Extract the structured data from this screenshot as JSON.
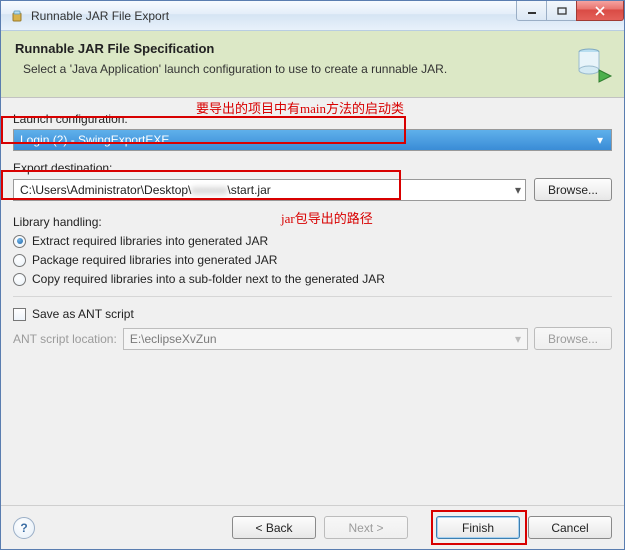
{
  "title": "Runnable JAR File Export",
  "banner": {
    "title": "Runnable JAR File Specification",
    "desc": "Select a 'Java Application' launch configuration to use to create a runnable JAR."
  },
  "labels": {
    "launch_config": "Launch configuration:",
    "export_dest": "Export destination:",
    "library_handling": "Library handling:",
    "ant_script_location": "ANT script location:"
  },
  "launch_config_value": "Login (2) - SwingExportEXE",
  "export_dest_prefix": "C:\\Users\\Administrator\\Desktop\\",
  "export_dest_hidden": "xxxxxx",
  "export_dest_suffix": "\\start.jar",
  "buttons": {
    "browse": "Browse...",
    "back": "< Back",
    "next": "Next >",
    "finish": "Finish",
    "cancel": "Cancel"
  },
  "radios": {
    "extract": "Extract required libraries into generated JAR",
    "package": "Package required libraries into generated JAR",
    "copy": "Copy required libraries into a sub-folder next to the generated JAR"
  },
  "checkbox_ant": "Save as ANT script",
  "ant_location": "E:\\eclipseXvZun",
  "annotations": {
    "top": "要导出的项目中有main方法的启动类",
    "mid": "jar包导出的路径"
  }
}
